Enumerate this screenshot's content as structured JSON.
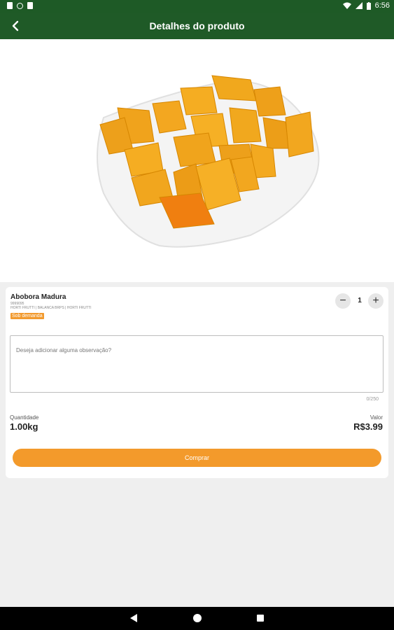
{
  "status_bar": {
    "time": "6:56"
  },
  "app_bar": {
    "title": "Detalhes do produto"
  },
  "product": {
    "name": "Abobora Madura",
    "code": "9999095",
    "store": "HORTI FRUTTI | BALANCA BRPS | HORTI FRUTTI",
    "badge": "Sob demanda"
  },
  "quantity_stepper": {
    "minus": "−",
    "value": "1",
    "plus": "+"
  },
  "observation": {
    "placeholder": "Deseja adicionar alguma observação?",
    "counter": "0/250"
  },
  "summary": {
    "quantity_label": "Quantidade",
    "quantity_value": "1.00kg",
    "price_label": "Valor",
    "price_value": "R$3.99"
  },
  "buy_button": {
    "label": "Comprar"
  },
  "colors": {
    "header_green": "#1f5a27",
    "accent_orange": "#f39a2b"
  }
}
